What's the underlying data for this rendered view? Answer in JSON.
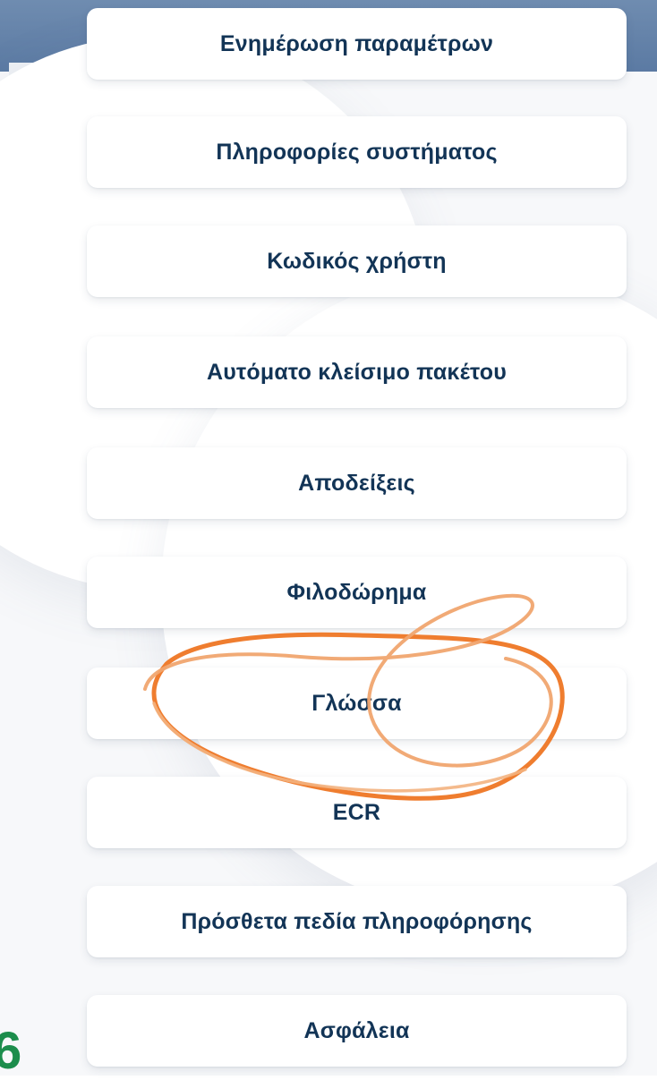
{
  "menu": {
    "items": [
      {
        "label": "Ενημέρωση παραμέτρων"
      },
      {
        "label": "Πληροφορίες συστήματος"
      },
      {
        "label": "Κωδικός χρήστη"
      },
      {
        "label": "Αυτόματο κλείσιμο πακέτου"
      },
      {
        "label": "Αποδείξεις"
      },
      {
        "label": "Φιλοδώρημα"
      },
      {
        "label": "Γλώσσα"
      },
      {
        "label": "ECR"
      },
      {
        "label": "Πρόσθετα πεδία πληροφόρησης"
      },
      {
        "label": "Ασφάλεια"
      }
    ]
  },
  "colors": {
    "header_band": "#5b7aa3",
    "menu_text": "#123456",
    "annotation_orange": "#ef7d2f",
    "corner_mark": "#1c8d4c"
  },
  "corner_mark": {
    "text": "6"
  }
}
